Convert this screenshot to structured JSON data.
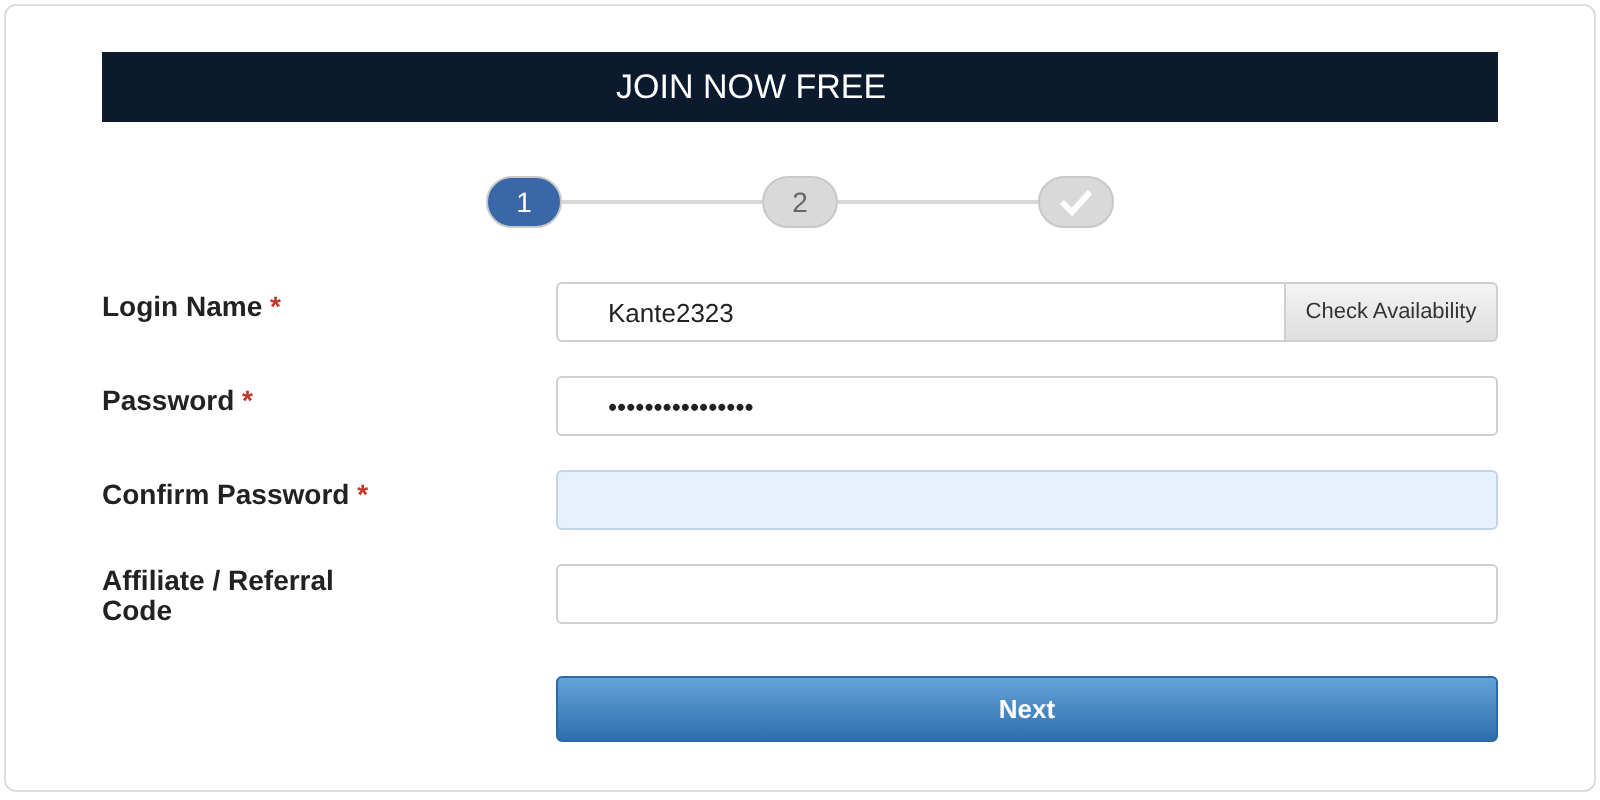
{
  "header": {
    "title": "JOIN NOW FREE"
  },
  "steps": [
    {
      "label": "1",
      "kind": "number",
      "selected": true
    },
    {
      "label": "2",
      "kind": "number",
      "selected": false
    },
    {
      "kind": "check",
      "selected": false
    }
  ],
  "fields": [
    {
      "label": "Login Name",
      "required": "*",
      "value": "Kante2323",
      "focused": false,
      "button": "Check Availability"
    },
    {
      "label": "Password",
      "required": "*",
      "value": "••••••••••••••••",
      "focused": false
    },
    {
      "label": "Confirm Password",
      "required": "*",
      "focused": true
    },
    {
      "label": "Affiliate / Referral Code",
      "focused": false
    }
  ],
  "submit": {
    "label": "Next"
  }
}
